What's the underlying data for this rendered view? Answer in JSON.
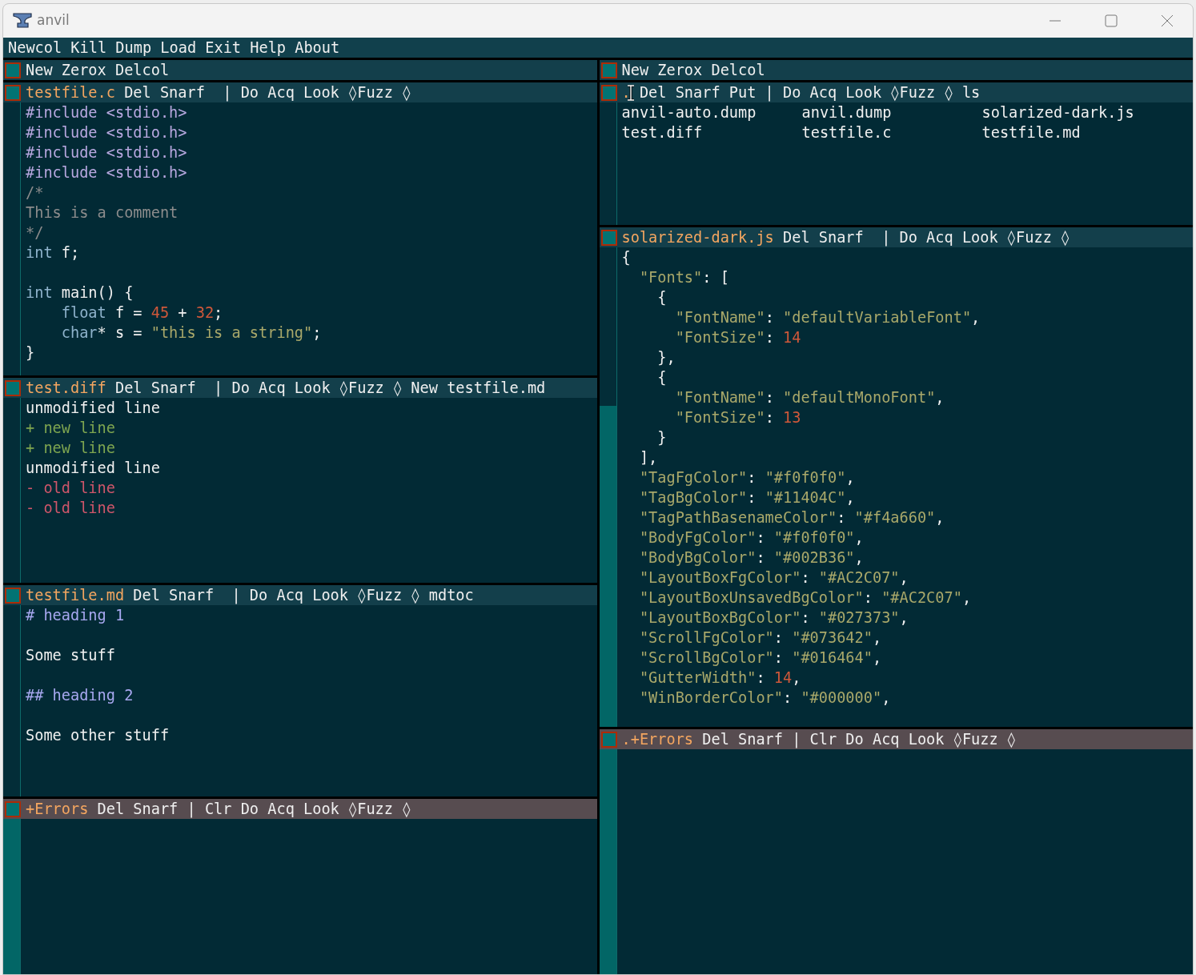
{
  "window": {
    "title": "anvil"
  },
  "main_tag": "Newcol Kill Dump Load Exit Help About",
  "columns": [
    {
      "tag": "New Zerox Delcol",
      "windows": [
        {
          "kind": "file",
          "path": "testfile.c",
          "commands": "Del Snarf  | Do Acq Look ◊Fuzz ◊",
          "pointer_over_tag": false,
          "lines": [
            {
              "kind": "code",
              "segments": [
                {
                  "text": "#include <stdio.h>",
                  "kind": "preproc"
                }
              ]
            },
            {
              "kind": "code",
              "segments": [
                {
                  "text": "#include <stdio.h>",
                  "kind": "preproc"
                }
              ]
            },
            {
              "kind": "code",
              "segments": [
                {
                  "text": "#include <stdio.h>",
                  "kind": "preproc"
                }
              ]
            },
            {
              "kind": "code",
              "segments": [
                {
                  "text": "#include <stdio.h>",
                  "kind": "preproc"
                }
              ]
            },
            {
              "kind": "code",
              "segments": [
                {
                  "text": "/*",
                  "kind": "comment"
                }
              ]
            },
            {
              "kind": "code",
              "segments": [
                {
                  "text": "This is a comment",
                  "kind": "comment"
                }
              ]
            },
            {
              "kind": "code",
              "segments": [
                {
                  "text": "*/",
                  "kind": "comment"
                }
              ]
            },
            {
              "kind": "code",
              "segments": [
                {
                  "text": "int",
                  "kind": "keyword"
                },
                {
                  "text": " f;",
                  "kind": "plain"
                }
              ]
            },
            {
              "kind": "blank"
            },
            {
              "kind": "code",
              "segments": [
                {
                  "text": "int",
                  "kind": "keyword"
                },
                {
                  "text": " main() {",
                  "kind": "plain"
                }
              ]
            },
            {
              "kind": "code",
              "segments": [
                {
                  "text": "    float",
                  "kind": "keyword"
                },
                {
                  "text": " f = ",
                  "kind": "plain"
                },
                {
                  "text": "45",
                  "kind": "number"
                },
                {
                  "text": " + ",
                  "kind": "plain"
                },
                {
                  "text": "32",
                  "kind": "number"
                },
                {
                  "text": ";",
                  "kind": "plain"
                }
              ]
            },
            {
              "kind": "code",
              "segments": [
                {
                  "text": "    char",
                  "kind": "keyword"
                },
                {
                  "text": "* s = ",
                  "kind": "plain"
                },
                {
                  "text": "\"this is a string\"",
                  "kind": "string"
                },
                {
                  "text": ";",
                  "kind": "plain"
                }
              ]
            },
            {
              "kind": "code",
              "segments": [
                {
                  "text": "}",
                  "kind": "plain"
                }
              ]
            }
          ]
        },
        {
          "kind": "file",
          "path": "test.diff",
          "commands": "Del Snarf  | Do Acq Look ◊Fuzz ◊ New testfile.md",
          "pointer_over_tag": false,
          "lines": [
            {
              "kind": "code",
              "segments": [
                {
                  "text": "unmodified line",
                  "kind": "plain"
                }
              ]
            },
            {
              "kind": "code",
              "segments": [
                {
                  "text": "+ new line",
                  "kind": "added"
                }
              ]
            },
            {
              "kind": "code",
              "segments": [
                {
                  "text": "+ new line",
                  "kind": "added"
                }
              ]
            },
            {
              "kind": "code",
              "segments": [
                {
                  "text": "unmodified line",
                  "kind": "plain"
                }
              ]
            },
            {
              "kind": "code",
              "segments": [
                {
                  "text": "- old line",
                  "kind": "removed"
                }
              ]
            },
            {
              "kind": "code",
              "segments": [
                {
                  "text": "- old line",
                  "kind": "removed"
                }
              ]
            }
          ]
        },
        {
          "kind": "file",
          "path": "testfile.md",
          "commands": "Del Snarf  | Do Acq Look ◊Fuzz ◊ mdtoc",
          "pointer_over_tag": false,
          "lines": [
            {
              "kind": "code",
              "segments": [
                {
                  "text": "# heading 1",
                  "kind": "heading"
                }
              ]
            },
            {
              "kind": "blank"
            },
            {
              "kind": "code",
              "segments": [
                {
                  "text": "Some stuff",
                  "kind": "plain"
                }
              ]
            },
            {
              "kind": "blank"
            },
            {
              "kind": "code",
              "segments": [
                {
                  "text": "## heading 2",
                  "kind": "heading"
                }
              ]
            },
            {
              "kind": "blank"
            },
            {
              "kind": "code",
              "segments": [
                {
                  "text": "Some other stuff",
                  "kind": "plain"
                }
              ]
            }
          ]
        },
        {
          "kind": "errors",
          "path": "+Errors",
          "commands": "Del Snarf | Clr Do Acq Look ◊Fuzz ◊",
          "pointer_over_tag": false
        }
      ]
    },
    {
      "tag": "New Zerox Delcol",
      "windows": [
        {
          "kind": "directory",
          "path": ".",
          "commands": "Del Snarf Put | Do Acq Look ◊Fuzz ◊ ls",
          "pointer_over_tag": true,
          "entries": [
            "anvil-auto.dump",
            "anvil.dump",
            "solarized-dark.js",
            "test.diff",
            "testfile.c",
            "testfile.md"
          ]
        },
        {
          "kind": "file",
          "path": "solarized-dark.js",
          "commands": "Del Snarf  | Do Acq Look ◊Fuzz ◊",
          "pointer_over_tag": false,
          "lines": [
            {
              "kind": "code",
              "segments": [
                {
                  "text": "{",
                  "kind": "plain"
                }
              ]
            },
            {
              "kind": "code",
              "segments": [
                {
                  "text": "  \"Fonts\"",
                  "kind": "string"
                },
                {
                  "text": ": [",
                  "kind": "plain"
                }
              ]
            },
            {
              "kind": "code",
              "segments": [
                {
                  "text": "    {",
                  "kind": "plain"
                }
              ]
            },
            {
              "kind": "code",
              "segments": [
                {
                  "text": "      \"FontName\"",
                  "kind": "string"
                },
                {
                  "text": ": ",
                  "kind": "plain"
                },
                {
                  "text": "\"defaultVariableFont\"",
                  "kind": "string"
                },
                {
                  "text": ",",
                  "kind": "plain"
                }
              ]
            },
            {
              "kind": "code",
              "segments": [
                {
                  "text": "      \"FontSize\"",
                  "kind": "string"
                },
                {
                  "text": ": ",
                  "kind": "plain"
                },
                {
                  "text": "14",
                  "kind": "number"
                }
              ]
            },
            {
              "kind": "code",
              "segments": [
                {
                  "text": "    },",
                  "kind": "plain"
                }
              ]
            },
            {
              "kind": "code",
              "segments": [
                {
                  "text": "    {",
                  "kind": "plain"
                }
              ]
            },
            {
              "kind": "code",
              "segments": [
                {
                  "text": "      \"FontName\"",
                  "kind": "string"
                },
                {
                  "text": ": ",
                  "kind": "plain"
                },
                {
                  "text": "\"defaultMonoFont\"",
                  "kind": "string"
                },
                {
                  "text": ",",
                  "kind": "plain"
                }
              ]
            },
            {
              "kind": "code",
              "segments": [
                {
                  "text": "      \"FontSize\"",
                  "kind": "string"
                },
                {
                  "text": ": ",
                  "kind": "plain"
                },
                {
                  "text": "13",
                  "kind": "number"
                }
              ]
            },
            {
              "kind": "code",
              "segments": [
                {
                  "text": "    }",
                  "kind": "plain"
                }
              ]
            },
            {
              "kind": "code",
              "segments": [
                {
                  "text": "  ],",
                  "kind": "plain"
                }
              ]
            },
            {
              "kind": "code",
              "segments": [
                {
                  "text": "  \"TagFgColor\"",
                  "kind": "string"
                },
                {
                  "text": ": ",
                  "kind": "plain"
                },
                {
                  "text": "\"#f0f0f0\"",
                  "kind": "string"
                },
                {
                  "text": ",",
                  "kind": "plain"
                }
              ]
            },
            {
              "kind": "code",
              "segments": [
                {
                  "text": "  \"TagBgColor\"",
                  "kind": "string"
                },
                {
                  "text": ": ",
                  "kind": "plain"
                },
                {
                  "text": "\"#11404C\"",
                  "kind": "string"
                },
                {
                  "text": ",",
                  "kind": "plain"
                }
              ]
            },
            {
              "kind": "code",
              "segments": [
                {
                  "text": "  \"TagPathBasenameColor\"",
                  "kind": "string"
                },
                {
                  "text": ": ",
                  "kind": "plain"
                },
                {
                  "text": "\"#f4a660\"",
                  "kind": "string"
                },
                {
                  "text": ",",
                  "kind": "plain"
                }
              ]
            },
            {
              "kind": "code",
              "segments": [
                {
                  "text": "  \"BodyFgColor\"",
                  "kind": "string"
                },
                {
                  "text": ": ",
                  "kind": "plain"
                },
                {
                  "text": "\"#f0f0f0\"",
                  "kind": "string"
                },
                {
                  "text": ",",
                  "kind": "plain"
                }
              ]
            },
            {
              "kind": "code",
              "segments": [
                {
                  "text": "  \"BodyBgColor\"",
                  "kind": "string"
                },
                {
                  "text": ": ",
                  "kind": "plain"
                },
                {
                  "text": "\"#002B36\"",
                  "kind": "string"
                },
                {
                  "text": ",",
                  "kind": "plain"
                }
              ]
            },
            {
              "kind": "code",
              "segments": [
                {
                  "text": "  \"LayoutBoxFgColor\"",
                  "kind": "string"
                },
                {
                  "text": ": ",
                  "kind": "plain"
                },
                {
                  "text": "\"#AC2C07\"",
                  "kind": "string"
                },
                {
                  "text": ",",
                  "kind": "plain"
                }
              ]
            },
            {
              "kind": "code",
              "segments": [
                {
                  "text": "  \"LayoutBoxUnsavedBgColor\"",
                  "kind": "string"
                },
                {
                  "text": ": ",
                  "kind": "plain"
                },
                {
                  "text": "\"#AC2C07\"",
                  "kind": "string"
                },
                {
                  "text": ",",
                  "kind": "plain"
                }
              ]
            },
            {
              "kind": "code",
              "segments": [
                {
                  "text": "  \"LayoutBoxBgColor\"",
                  "kind": "string"
                },
                {
                  "text": ": ",
                  "kind": "plain"
                },
                {
                  "text": "\"#027373\"",
                  "kind": "string"
                },
                {
                  "text": ",",
                  "kind": "plain"
                }
              ]
            },
            {
              "kind": "code",
              "segments": [
                {
                  "text": "  \"ScrollFgColor\"",
                  "kind": "string"
                },
                {
                  "text": ": ",
                  "kind": "plain"
                },
                {
                  "text": "\"#073642\"",
                  "kind": "string"
                },
                {
                  "text": ",",
                  "kind": "plain"
                }
              ]
            },
            {
              "kind": "code",
              "segments": [
                {
                  "text": "  \"ScrollBgColor\"",
                  "kind": "string"
                },
                {
                  "text": ": ",
                  "kind": "plain"
                },
                {
                  "text": "\"#016464\"",
                  "kind": "string"
                },
                {
                  "text": ",",
                  "kind": "plain"
                }
              ]
            },
            {
              "kind": "code",
              "segments": [
                {
                  "text": "  \"GutterWidth\"",
                  "kind": "string"
                },
                {
                  "text": ": ",
                  "kind": "plain"
                },
                {
                  "text": "14",
                  "kind": "number"
                },
                {
                  "text": ",",
                  "kind": "plain"
                }
              ]
            },
            {
              "kind": "code",
              "segments": [
                {
                  "text": "  \"WinBorderColor\"",
                  "kind": "string"
                },
                {
                  "text": ": ",
                  "kind": "plain"
                },
                {
                  "text": "\"#000000\"",
                  "kind": "string"
                },
                {
                  "text": ",",
                  "kind": "plain"
                }
              ]
            }
          ]
        },
        {
          "kind": "errors",
          "path": ".+Errors",
          "commands": "Del Snarf | Clr Do Acq Look ◊Fuzz ◊",
          "pointer_over_tag": false
        }
      ]
    }
  ]
}
